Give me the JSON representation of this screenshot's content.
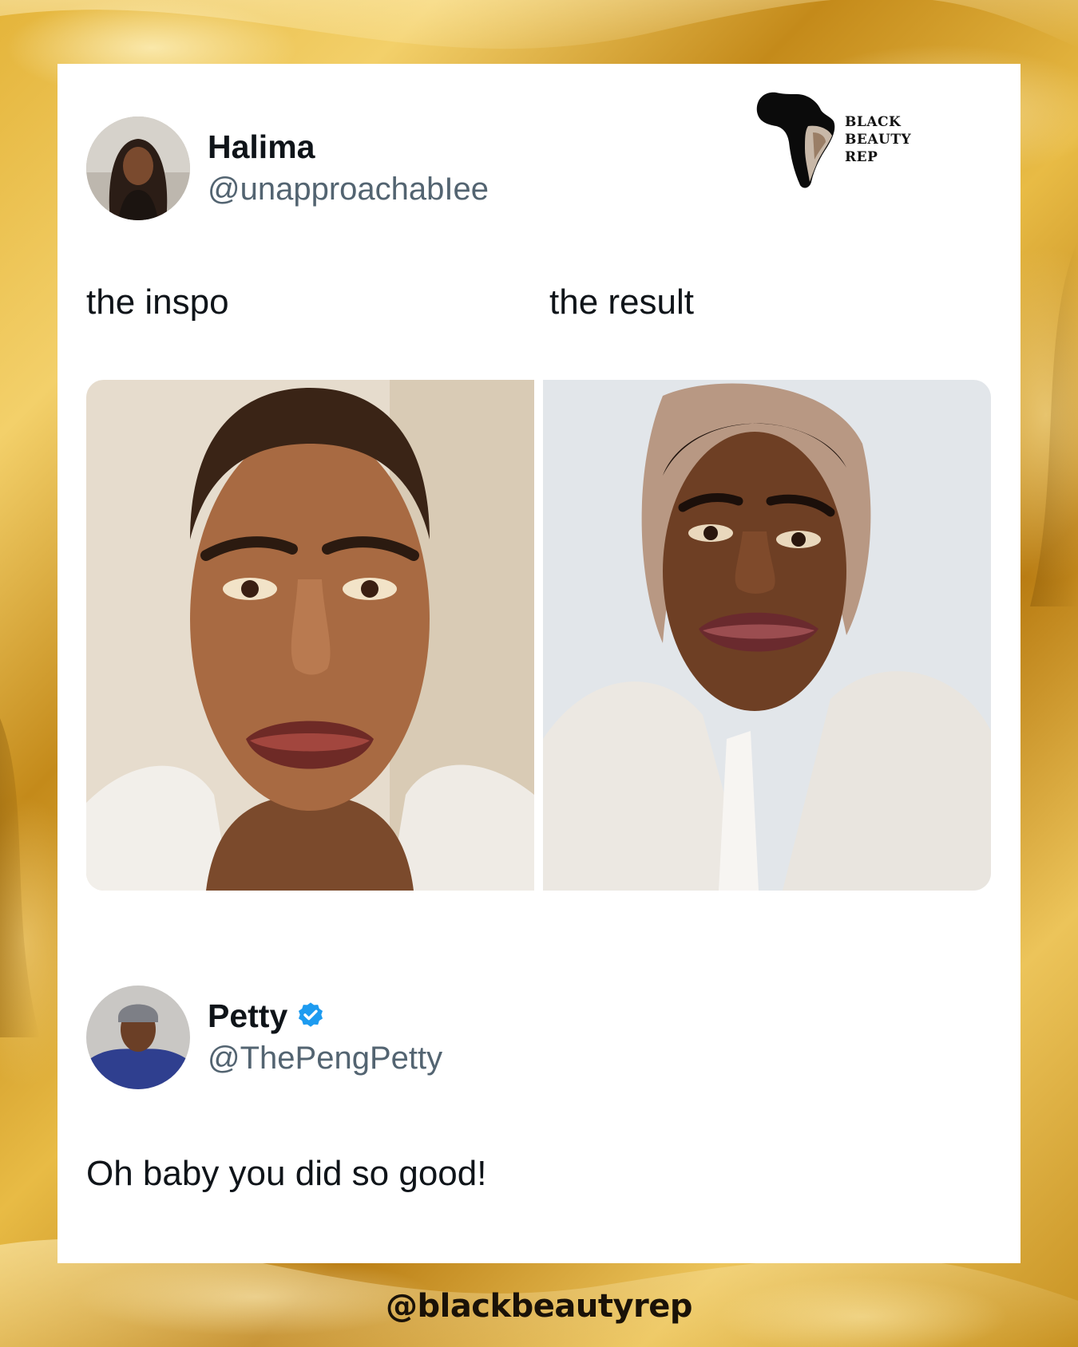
{
  "post": {
    "author": {
      "display_name": "Halima",
      "handle": "@unapproachabIee"
    },
    "captions": {
      "left": "the inspo",
      "right": "the result"
    },
    "images": {
      "left": "inspo-makeup-photo",
      "right": "result-makeup-photo"
    }
  },
  "reply": {
    "author": {
      "display_name": "Petty",
      "handle": "@ThePengPetty",
      "verified": true
    },
    "text": "Oh baby you did so good!"
  },
  "branding": {
    "logo_lines": [
      "BLACK",
      "BEAUTY",
      "REP"
    ],
    "footer_handle": "@blackbeautyrep"
  },
  "colors": {
    "background_gold": "#d9a52e",
    "card": "#ffffff",
    "verified_blue": "#1d9bf0",
    "text_primary": "#0f1419",
    "text_secondary": "#536471"
  }
}
